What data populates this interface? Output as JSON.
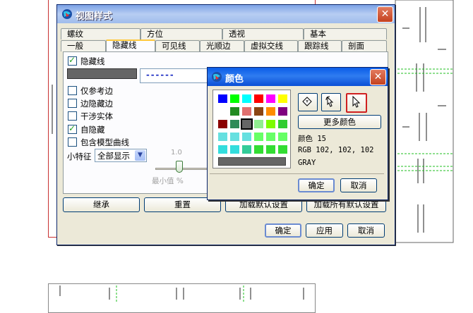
{
  "main_dialog": {
    "title": "视图样式",
    "tabs_row1": [
      "螺纹",
      "方位",
      "透视",
      "基本"
    ],
    "tabs_row2": [
      "一般",
      "隐藏线",
      "可见线",
      "光顺边",
      "虚拟交线",
      "跟踪线",
      "剖面"
    ],
    "active_tab": "隐藏线",
    "hidden_lines_checkbox": {
      "label": "隐藏线",
      "checked": true
    },
    "line_style_value": "------",
    "options": [
      {
        "label": "仅参考边",
        "checked": false
      },
      {
        "label": "边隐藏边",
        "checked": false
      },
      {
        "label": "干涉实体",
        "checked": false
      },
      {
        "label": "自隐藏",
        "checked": true
      },
      {
        "label": "包含模型曲线",
        "checked": false
      }
    ],
    "small_feature_label": "小特征",
    "small_feature_value": "全部显示",
    "slider_value_label": "1.0",
    "slider_min_label": "最小值 %",
    "row_buttons": [
      "继承",
      "重置",
      "加载默认设置",
      "加载所有默认设置"
    ],
    "footer_buttons": {
      "ok": "确定",
      "apply": "应用",
      "cancel": "取消"
    }
  },
  "color_dialog": {
    "title": "颜色",
    "more_colors_label": "更多颜色",
    "color_index_label": "颜色  15",
    "rgb_label": "RGB 102, 102, 102",
    "name_label": "GRAY",
    "ok": "确定",
    "cancel": "取消",
    "selected_color": "#666666",
    "palette_rows": [
      [
        "#0000ff",
        "#00ff00",
        "#00ffff",
        "#ff0000",
        "#ff00ff",
        "#ffff00"
      ],
      [
        "#ffffff",
        "#228b22",
        "#e07070",
        "#8b4513",
        "#ff8c00",
        "#800080"
      ],
      [
        "#8b0000",
        "#2e8b57",
        "#666666",
        "#90ee90",
        "#7cfc00",
        "#32cd32"
      ],
      [
        "#66e0e0",
        "#66e0e0",
        "#66e0e0",
        "#66ff66",
        "#66ff66",
        "#66ff66"
      ],
      [
        "#33dddd",
        "#33dddd",
        "#33cc99",
        "#33dd33",
        "#33dd33",
        "#33dd33"
      ]
    ]
  }
}
